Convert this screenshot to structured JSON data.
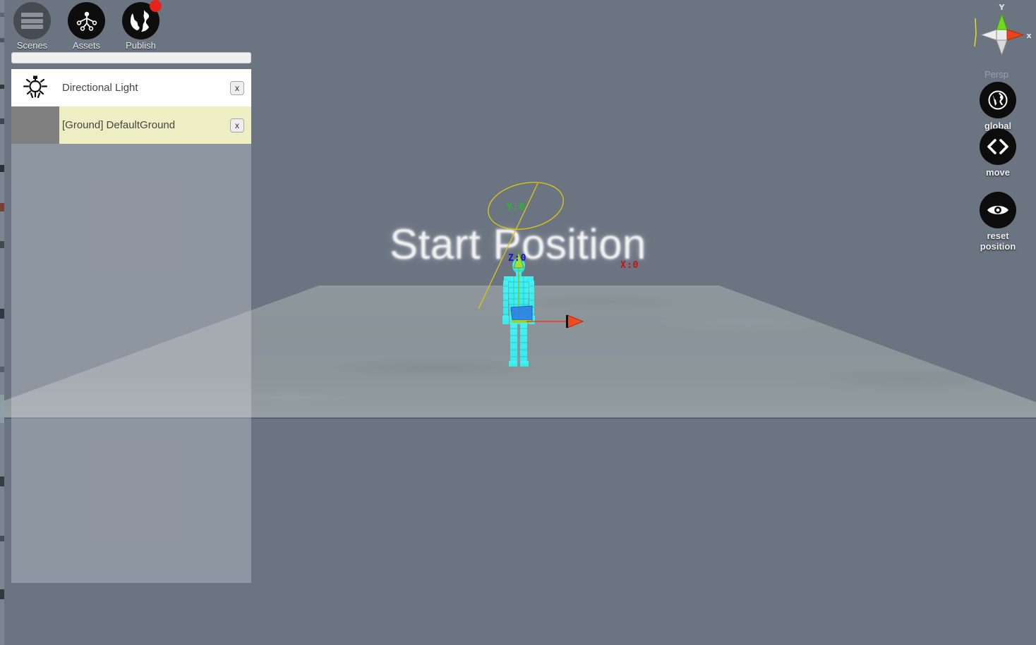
{
  "app": {
    "background_color": "#6b7481",
    "ground_color": "#8a9499",
    "accent_selected_row": "#eeeec4"
  },
  "toolbar": {
    "items": [
      {
        "label": "Scenes",
        "icon": "hamburger-icon",
        "badge": false
      },
      {
        "label": "Assets",
        "icon": "avatar-figure-icon",
        "badge": false
      },
      {
        "label": "Publish",
        "icon": "globe-icon",
        "badge": true
      }
    ]
  },
  "scene_name_field": {
    "value": "",
    "placeholder": ""
  },
  "object_list": {
    "rows": [
      {
        "label": "Directional Light",
        "icon": "light-bulb-icon",
        "close_label": "x",
        "selected": false
      },
      {
        "label": "[Ground] DefaultGround",
        "icon": "thumbnail",
        "close_label": "x",
        "selected": true
      }
    ]
  },
  "viewport": {
    "overlay_title": "Start Position",
    "projection_label": "Persp",
    "axis_readouts": {
      "y": {
        "text": "Y:0",
        "color": "#1fbd26"
      },
      "z": {
        "text": "Z:0",
        "color": "#1414c8"
      },
      "x": {
        "text": "X:0",
        "color": "#cc1111"
      }
    },
    "axis_gizmo": {
      "y_label": "Y",
      "x_label": "x",
      "y_axis_color": "#6fd81f",
      "x_axis_color": "#e8441a",
      "neutral_axis_color": "#e2e2e2"
    },
    "light_gizmo_color": "#d9c216",
    "character_wireframe_color": "#3ef6f6",
    "move_gizmo": {
      "x_handle_color": "#ee3b1c",
      "y_handle_color": "#9fe03a",
      "plane_handle_color": "#2f7fe0"
    }
  },
  "right_tools": [
    {
      "label": "global",
      "icon": "globe-icon"
    },
    {
      "label": "move",
      "icon": "move-arrows-icon"
    },
    {
      "label": "reset\nposition",
      "label_line1": "reset",
      "label_line2": "position",
      "icon": "eye-icon"
    }
  ]
}
